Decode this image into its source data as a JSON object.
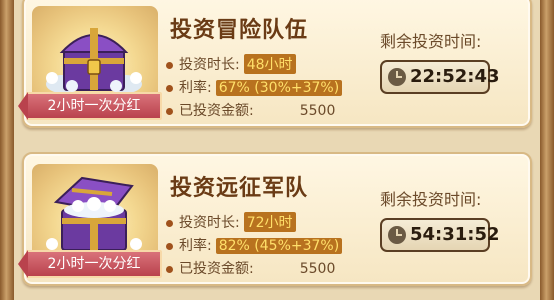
{
  "cards": [
    {
      "title": "投资冒险队伍",
      "duration_label": "投资时长:",
      "duration_value": "48小时",
      "rate_label": "利率:",
      "rate_value": "67% (30%+37%)",
      "invested_label": "已投资金额:",
      "invested_value": "5500",
      "remain_label": "剩余投资时间:",
      "timer": "22:52:43",
      "ribbon": "2小时一次分红",
      "chest_icon": "purple-treasure-chest-closed"
    },
    {
      "title": "投资远征军队",
      "duration_label": "投资时长:",
      "duration_value": "72小时",
      "rate_label": "利率:",
      "rate_value": "82% (45%+37%)",
      "invested_label": "已投资金额:",
      "invested_value": "5500",
      "remain_label": "剩余投资时间:",
      "timer": "54:31:52",
      "ribbon": "2小时一次分红",
      "chest_icon": "purple-treasure-chest-open"
    }
  ],
  "colors": {
    "background": "#e9d8b4",
    "title": "#6a3b15",
    "highlight_bg": "#b8721f",
    "highlight_text": "#ffdf6a",
    "ribbon": "#c4535d"
  }
}
